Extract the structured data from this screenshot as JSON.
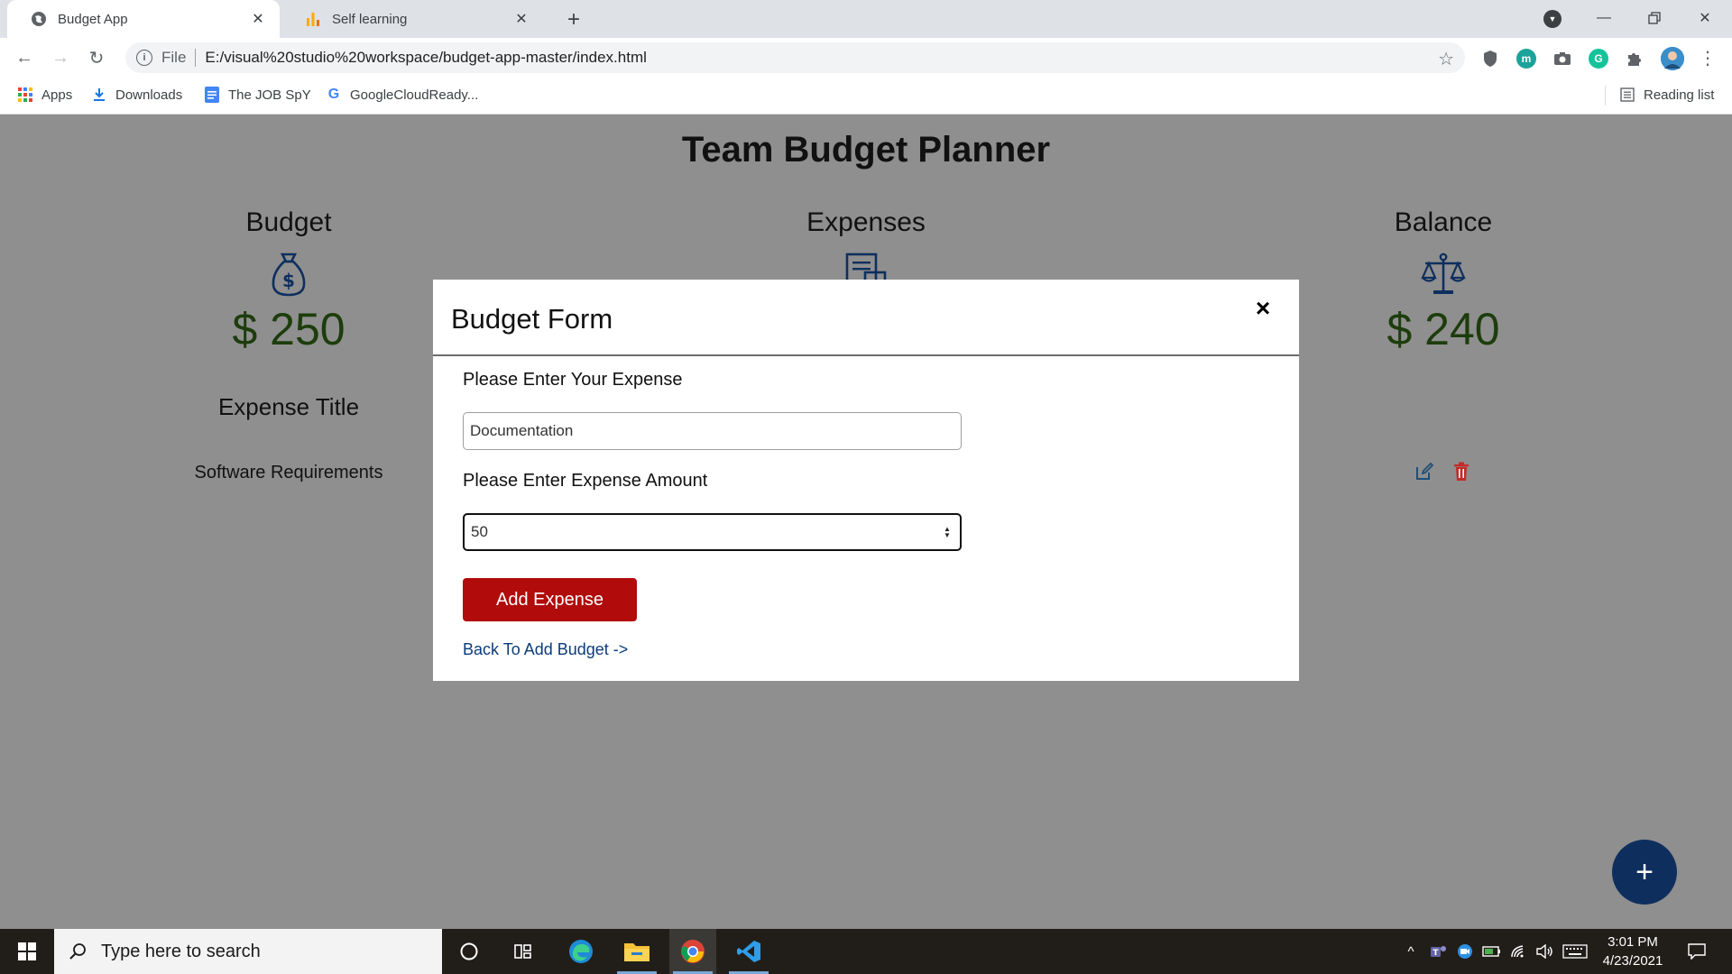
{
  "browser": {
    "tabs": [
      {
        "title": "Budget App",
        "active": true
      },
      {
        "title": "Self learning",
        "active": false
      }
    ],
    "address": {
      "scheme": "File",
      "url": "E:/visual%20studio%20workspace/budget-app-master/index.html"
    },
    "bookmarks": [
      {
        "label": "Apps"
      },
      {
        "label": "Downloads"
      },
      {
        "label": "The JOB SpY"
      },
      {
        "label": "GoogleCloudReady..."
      }
    ],
    "reading_list": "Reading list",
    "extensions": [
      {
        "icon": "shield-extension-icon"
      },
      {
        "icon": "meet-extension-icon",
        "glyph": "m",
        "color": "#1aa39a"
      },
      {
        "icon": "camera-extension-icon"
      },
      {
        "icon": "grammarly-extension-icon",
        "glyph": "G",
        "color": "#15c39a"
      },
      {
        "icon": "puzzle-extensions-icon"
      }
    ]
  },
  "page": {
    "title": "Team Budget Planner",
    "budget": {
      "label": "Budget",
      "amount": "$ 250"
    },
    "expenses": {
      "label": "Expenses"
    },
    "balance": {
      "label": "Balance",
      "amount": "$ 240"
    },
    "list": {
      "header": "Expense Title",
      "items": [
        {
          "title": "Software Requirements"
        }
      ]
    },
    "colors": {
      "amount": "#1d3d0c",
      "icon": "#0e2f5e",
      "delete": "#c62828",
      "fab": "#0e2f5e",
      "button": "#b10b0b"
    }
  },
  "modal": {
    "title": "Budget Form",
    "close_glyph": "×",
    "expense_label": "Please Enter Your Expense",
    "expense_value": "Documentation",
    "amount_label": "Please Enter Expense Amount",
    "amount_value": "50",
    "submit_label": "Add Expense",
    "back_link": "Back To Add Budget ->"
  },
  "fab": {
    "glyph": "+"
  },
  "taskbar": {
    "search_placeholder": "Type here to search",
    "apps": [
      "cortana",
      "task-view",
      "edge",
      "file-explorer",
      "chrome",
      "vscode"
    ],
    "clock": {
      "time": "3:01 PM",
      "date": "4/23/2021"
    }
  }
}
